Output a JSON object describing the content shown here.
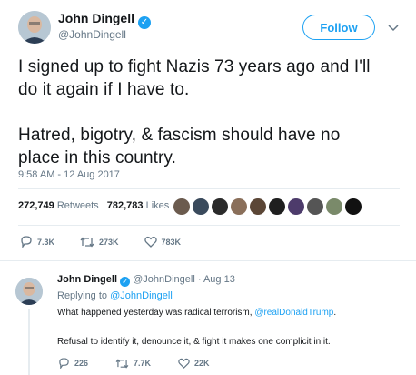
{
  "tweet": {
    "author_name": "John Dingell",
    "author_handle": "@JohnDingell",
    "follow_label": "Follow",
    "text_line1": "I signed up to fight Nazis 73 years ago and I'll",
    "text_line2": "do it again if I have to.",
    "text_line3": "Hatred, bigotry, & fascism should have no",
    "text_line4": "place in this country.",
    "timestamp": "9:58 AM - 12 Aug 2017",
    "retweets_count": "272,749",
    "retweets_label": "Retweets",
    "likes_count": "782,783",
    "likes_label": "Likes",
    "reply_count": "7.3K",
    "retweet_count_short": "273K",
    "like_count_short": "783K",
    "liker_colors": [
      "#6b5b4e",
      "#3a4a5c",
      "#2b2b2b",
      "#8a6f5a",
      "#5b4636",
      "#1f1f1f",
      "#4d3b6b",
      "#555555",
      "#7a8a6a",
      "#111111"
    ]
  },
  "reply": {
    "author_name": "John Dingell",
    "author_handle": "@JohnDingell",
    "separator": "·",
    "date": "Aug 13",
    "replying_to_label": "Replying to",
    "replying_to_handle": "@JohnDingell",
    "text_part1": "What happened yesterday was radical terrorism,",
    "text_mention": "@realDonaldTrump",
    "text_part2": ".",
    "text_line2": "Refusal to identify it, denounce it, & fight it makes one complicit in it.",
    "reply_count": "226",
    "retweet_count": "7.7K",
    "like_count": "22K"
  },
  "colors": {
    "accent": "#1da1f2",
    "muted": "#657786",
    "divider": "#e6ecf0"
  }
}
